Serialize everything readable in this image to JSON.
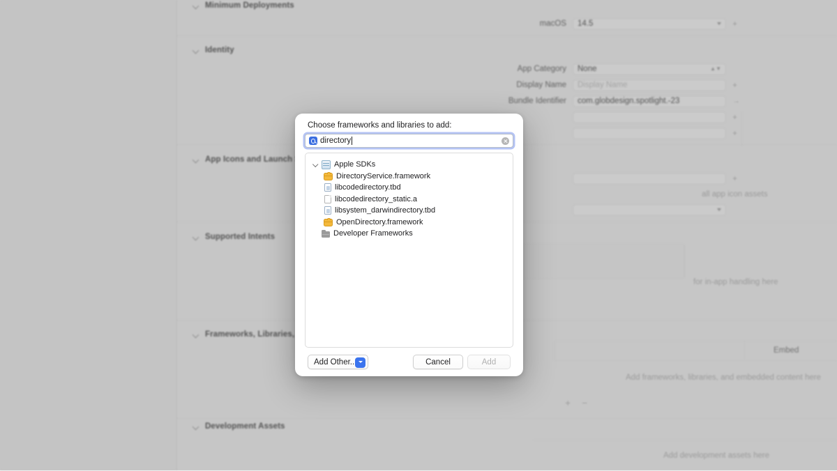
{
  "background": {
    "sections": [
      {
        "title": "Minimum Deployments"
      },
      {
        "title": "Identity"
      },
      {
        "title": "App Icons and Launch Screen"
      },
      {
        "title": "Supported Intents"
      },
      {
        "title": "Frameworks, Libraries, and Embedded Content"
      },
      {
        "title": "Development Assets"
      }
    ],
    "fields": {
      "macos_label": "macOS",
      "macos_value": "14.5",
      "app_category_label": "App Category",
      "app_category_value": "None",
      "display_name_label": "Display Name",
      "display_name_placeholder": "Display Name",
      "bundle_identifier_label": "Bundle Identifier",
      "bundle_identifier_value": "com.globdesign.spotlight.-23"
    },
    "hints": {
      "app_icon": "all app icon assets",
      "intents": "for in-app handling here",
      "frameworks": "Add frameworks, libraries, and embedded content here",
      "dev_assets": "Add development assets here"
    },
    "columns": {
      "embed": "Embed"
    },
    "add_remove": "+ −"
  },
  "sheet": {
    "title": "Choose frameworks and libraries to add:",
    "search": {
      "value": "directory",
      "icon": "search-icon",
      "clear_icon": "clear-icon"
    },
    "tree": [
      {
        "label": "Apple SDKs",
        "level": 0,
        "icon": "sdk-icon",
        "expanded": true,
        "twisty": true
      },
      {
        "label": "DirectoryService.framework",
        "level": 1,
        "icon": "framework-icon",
        "twisty": false
      },
      {
        "label": "libcodedirectory.tbd",
        "level": 1,
        "icon": "tbd-file-icon",
        "twisty": false
      },
      {
        "label": "libcodedirectory_static.a",
        "level": 1,
        "icon": "static-library-icon",
        "twisty": false
      },
      {
        "label": "libsystem_darwindirectory.tbd",
        "level": 1,
        "icon": "tbd-file-icon",
        "twisty": false
      },
      {
        "label": "OpenDirectory.framework",
        "level": 1,
        "icon": "framework-icon",
        "twisty": false
      },
      {
        "label": "Developer Frameworks",
        "level": 0,
        "icon": "folder-icon",
        "twisty": false
      }
    ],
    "buttons": {
      "add_other": "Add Other...",
      "cancel": "Cancel",
      "add": "Add"
    }
  },
  "colors": {
    "accent_blue": "#3b74ee",
    "focus_ring": "#587be6",
    "framework_yellow": "#f4b93c",
    "window_gray": "#cfcfcf"
  }
}
